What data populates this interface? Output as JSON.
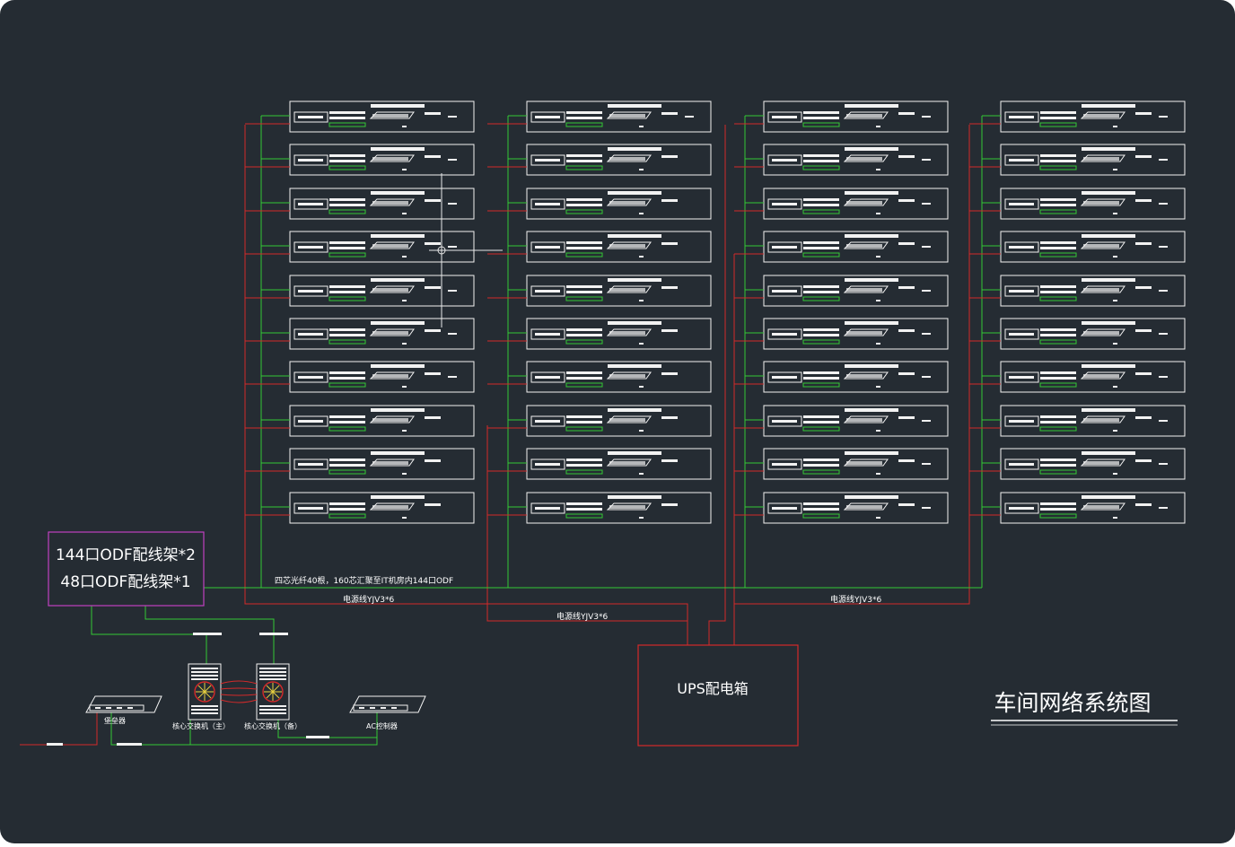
{
  "diagram": {
    "title": "车间网络系统图",
    "odf_lines": [
      "144口ODF配线架*2",
      "48口ODF配线架*1"
    ],
    "fiber_note": "四芯光纤40根，160芯汇聚至IT机房内144口ODF",
    "power_labels": [
      "电源线YJV3*6",
      "电源线YJV3*6",
      "电源线YJV3*6"
    ],
    "ups_label": "UPS配电箱",
    "devices": [
      "堡垒器",
      "核心交换机（主）",
      "核心交换机（备）",
      "AC控制器"
    ],
    "rack_columns": [
      {
        "racks": 10
      },
      {
        "racks": 10
      },
      {
        "racks": 10
      },
      {
        "racks": 10
      }
    ]
  },
  "colors": {
    "background": "#252c33",
    "frame": "#ffffff",
    "green_line": "#34c934",
    "red_line": "#d42a2a",
    "odf_border": "#c040c0",
    "text": "#ffffff"
  }
}
